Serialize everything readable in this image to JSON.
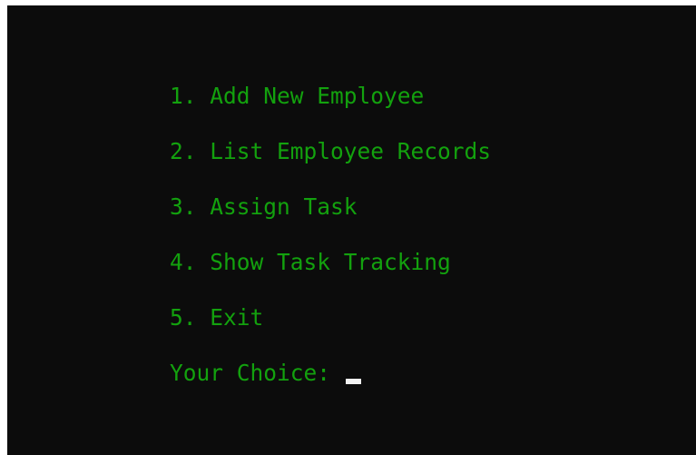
{
  "console": {
    "background_color": "#0c0c0c",
    "text_color": "#13a10e",
    "cursor_color": "#f2f2f2",
    "menu_items": [
      {
        "label": "1. Add New Employee"
      },
      {
        "label": "2. List Employee Records"
      },
      {
        "label": "3. Assign Task"
      },
      {
        "label": "4. Show Task Tracking"
      },
      {
        "label": "5. Exit"
      }
    ],
    "prompt": "Your Choice: "
  }
}
